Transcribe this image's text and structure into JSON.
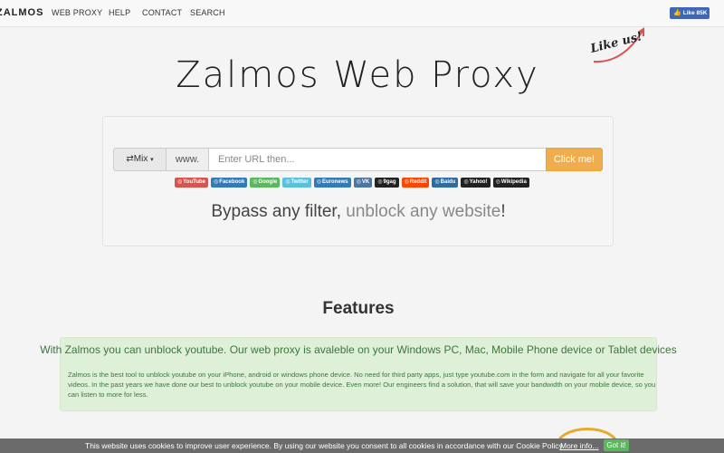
{
  "nav": {
    "logo": "ZALMOS",
    "links": [
      "WEB PROXY",
      "HELP",
      "CONTACT",
      "SEARCH"
    ],
    "fb_like": "Like 85K"
  },
  "sticker": {
    "text": "Like us!"
  },
  "hero": {
    "title": "Zalmos Web Proxy"
  },
  "proxy_form": {
    "mix_label": "Mix",
    "www_label": "www.",
    "url_placeholder": "Enter URL then...",
    "submit_label": "Click me!"
  },
  "quick_links": [
    {
      "label": "YouTube",
      "color": "#d9534f"
    },
    {
      "label": "Facebook",
      "color": "#337ab7"
    },
    {
      "label": "Google",
      "color": "#5cb85c"
    },
    {
      "label": "Twitter",
      "color": "#5bc0de"
    },
    {
      "label": "Euronews",
      "color": "#337ab7"
    },
    {
      "label": "VK",
      "color": "#4c75a3"
    },
    {
      "label": "9gag",
      "color": "#222222"
    },
    {
      "label": "Reddit",
      "color": "#ff4500"
    },
    {
      "label": "Baidu",
      "color": "#2e6da4"
    },
    {
      "label": "Yahoo!",
      "color": "#222222"
    },
    {
      "label": "Wikipedia",
      "color": "#222222"
    }
  ],
  "tagline": {
    "part1": "Bypass any filter,",
    "part2": "unblock any website",
    "part3": "!"
  },
  "features": {
    "heading": "Features",
    "lead": "With Zalmos you can unblock youtube. Our web proxy is avaleble on your Windows PC, Mac, Mobile Phone device or Tablet devices",
    "body": "Zalmos is the best tool to unblock youtube on your iPhone, android or windows phone device. No need for third party apps, just type youtube.com in the form and navigate for all your favorite videos. In the past years we have done our best to unblock youtube on your mobile device. Even more! Our engineers find a solution, that will save your bandwidth on your mobile device, so you can listen to more for less."
  },
  "cookie": {
    "text": "This website uses cookies to improve user experience. By using our website you consent to all cookies in accordance with our Cookie Policy.",
    "more": "More info...",
    "button": "Got it!"
  },
  "colors": {
    "accent": "#f0ad4e",
    "success_bg": "#dff0d8",
    "success_text": "#3c763d"
  }
}
